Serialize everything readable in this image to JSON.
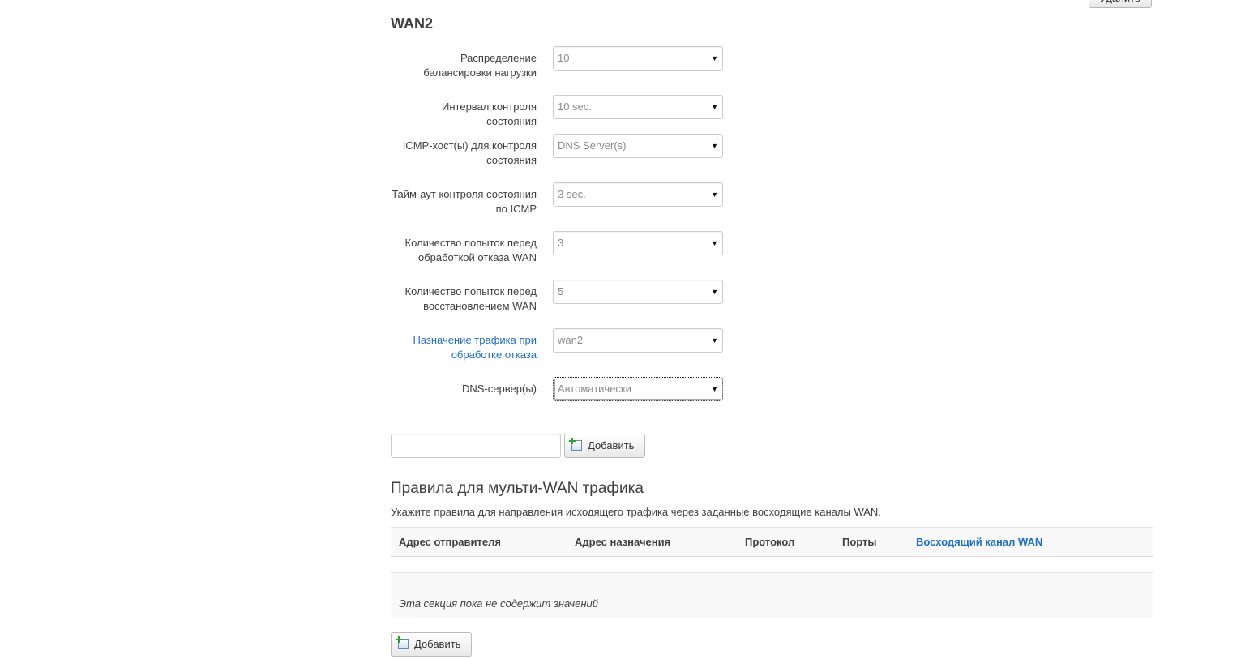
{
  "top_button": {
    "label": "Удалить"
  },
  "section": {
    "title": "WAN2"
  },
  "fields": [
    {
      "label_line1": "Распределение",
      "label_line2": "балансировки нагрузки",
      "value": "10"
    },
    {
      "label_line1": "Интервал контроля состояния",
      "label_line2": "",
      "value": "10 sec."
    },
    {
      "label_line1": "ICMP-хост(ы) для контроля",
      "label_line2": "состояния",
      "value": "DNS Server(s)"
    },
    {
      "label_line1": "Тайм-аут контроля состояния",
      "label_line2": "по ICMP",
      "value": "3 sec."
    },
    {
      "label_line1": "Количество попыток перед",
      "label_line2": "обработкой отказа WAN",
      "value": "3"
    },
    {
      "label_line1": "Количество попыток перед",
      "label_line2": "восстановлением WAN",
      "value": "5"
    },
    {
      "label_line1": "Назначение трафика при",
      "label_line2": "обработке отказа",
      "value": "wan2"
    },
    {
      "label_line1": "DNS-сервер(ы)",
      "label_line2": "",
      "value": "Автоматически"
    }
  ],
  "add_section": {
    "input_value": "",
    "button_label": "Добавить"
  },
  "rules": {
    "title": "Правила для мульти-WAN трафика",
    "description": "Укажите правила для направления исходящего трафика через заданные восходящие каналы WAN.",
    "columns": [
      "Адрес отправителя",
      "Адрес назначения",
      "Протокол",
      "Порты",
      "Восходящий канал WAN"
    ],
    "empty_text": "Эта секция пока не содержит значений",
    "add_button_label": "Добавить"
  },
  "colors": {
    "link": "#1f6fc6",
    "text": "#404040",
    "table_bg": "#f9f9f9"
  },
  "icons": {
    "add": "add-document-icon",
    "dropdown": "chevron-down-icon"
  }
}
